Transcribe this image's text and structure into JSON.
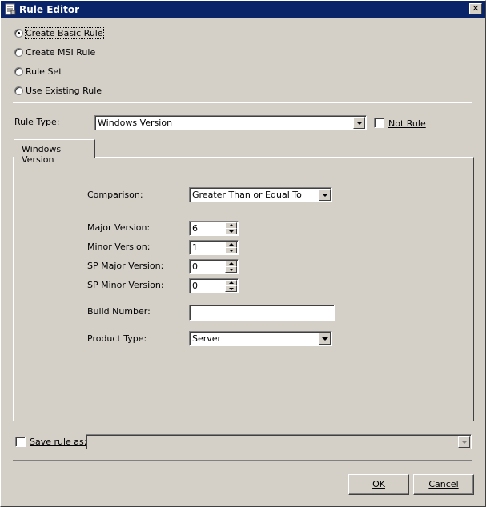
{
  "window": {
    "title": "Rule Editor",
    "close_glyph": "✕"
  },
  "rule_options": [
    {
      "label": "Create Basic Rule",
      "checked": true
    },
    {
      "label": "Create MSI Rule",
      "checked": false
    },
    {
      "label": "Rule Set",
      "checked": false
    },
    {
      "label": "Use Existing Rule",
      "checked": false
    }
  ],
  "rule_type": {
    "label": "Rule Type:",
    "value": "Windows Version",
    "not_rule_label": "Not Rule",
    "not_rule_checked": false
  },
  "tab": {
    "label": "Windows Version"
  },
  "form": {
    "comparison_label": "Comparison:",
    "comparison_value": "Greater Than or Equal To",
    "major_label": "Major Version:",
    "major_value": "6",
    "minor_label": "Minor Version:",
    "minor_value": "1",
    "sp_major_label": "SP Major Version:",
    "sp_major_value": "0",
    "sp_minor_label": "SP Minor Version:",
    "sp_minor_value": "0",
    "build_label": "Build Number:",
    "build_value": "",
    "product_type_label": "Product Type:",
    "product_type_value": "Server"
  },
  "save": {
    "label": "Save rule as:",
    "checked": false,
    "value": ""
  },
  "buttons": {
    "ok": "OK",
    "cancel": "Cancel"
  }
}
